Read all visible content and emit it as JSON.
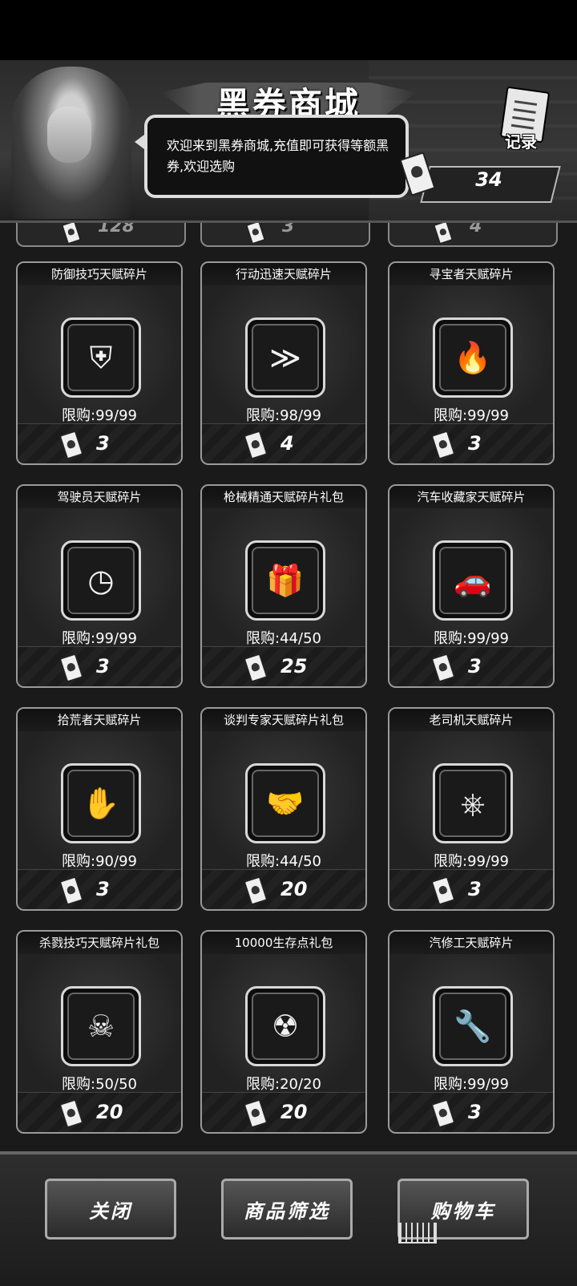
{
  "header": {
    "title": "黑券商城",
    "greeting": "欢迎来到黑券商城,充值即可获得等额黑券,欢迎选购",
    "records_label": "记录",
    "balance": "34"
  },
  "partial_row": [
    "128",
    "3",
    "4"
  ],
  "items": [
    {
      "name": "防御技巧天赋碎片",
      "limit": "限购:99/99",
      "price": "3",
      "icon": "shield-arrow-icon",
      "glyph": "⛨"
    },
    {
      "name": "行动迅速天赋碎片",
      "limit": "限购:98/99",
      "price": "4",
      "icon": "dash-icon",
      "glyph": "≫"
    },
    {
      "name": "寻宝者天赋碎片",
      "limit": "限购:99/99",
      "price": "3",
      "icon": "torch-door-icon",
      "glyph": "🔥"
    },
    {
      "name": "驾驶员天赋碎片",
      "limit": "限购:99/99",
      "price": "3",
      "icon": "clock-road-icon",
      "glyph": "◷"
    },
    {
      "name": "枪械精通天赋碎片礼包",
      "limit": "限购:44/50",
      "price": "25",
      "icon": "gift-weapon-icon",
      "glyph": "🎁"
    },
    {
      "name": "汽车收藏家天赋碎片",
      "limit": "限购:99/99",
      "price": "3",
      "icon": "sports-car-icon",
      "glyph": "🚗"
    },
    {
      "name": "拾荒者天赋碎片",
      "limit": "限购:90/99",
      "price": "3",
      "icon": "hand-bag-icon",
      "glyph": "✋"
    },
    {
      "name": "谈判专家天赋碎片礼包",
      "limit": "限购:44/50",
      "price": "20",
      "icon": "gift-handshake-icon",
      "glyph": "🤝"
    },
    {
      "name": "老司机天赋碎片",
      "limit": "限购:99/99",
      "price": "3",
      "icon": "steering-wheel-icon",
      "glyph": "⎈"
    },
    {
      "name": "杀戮技巧天赋碎片礼包",
      "limit": "限购:50/50",
      "price": "20",
      "icon": "gift-skull-icon",
      "glyph": "☠"
    },
    {
      "name": "10000生存点礼包",
      "limit": "限购:20/20",
      "price": "20",
      "icon": "gift-10000-icon",
      "glyph": "☢"
    },
    {
      "name": "汽修工天赋碎片",
      "limit": "限购:99/99",
      "price": "3",
      "icon": "wrench-tools-icon",
      "glyph": "🔧"
    }
  ],
  "footer": {
    "close_label": "关闭",
    "filter_label": "商品筛选",
    "cart_label": "购物车"
  }
}
